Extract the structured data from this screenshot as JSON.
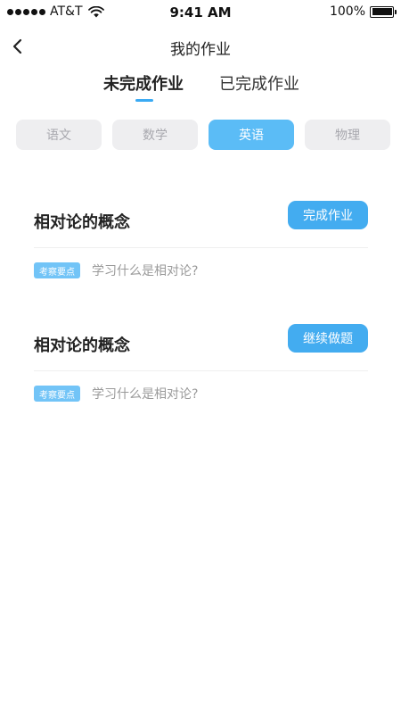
{
  "status_bar": {
    "carrier": "AT&T",
    "time": "9:41 AM",
    "battery": "100%"
  },
  "nav": {
    "title": "我的作业",
    "back_icon": "chevron-left-icon"
  },
  "tabs": [
    {
      "label": "未完成作业",
      "active": true
    },
    {
      "label": "已完成作业",
      "active": false
    }
  ],
  "subjects": [
    {
      "label": "语文",
      "selected": false
    },
    {
      "label": "数学",
      "selected": false
    },
    {
      "label": "英语",
      "selected": true
    },
    {
      "label": "物理",
      "selected": false
    }
  ],
  "assignments": [
    {
      "title": "相对论的概念",
      "action_label": "完成作业",
      "tag": "考察要点",
      "description": "学习什么是相对论?"
    },
    {
      "title": "相对论的概念",
      "action_label": "继续做题",
      "tag": "考察要点",
      "description": "学习什么是相对论?"
    }
  ],
  "colors": {
    "accent": "#43acf0",
    "chip_selected": "#5bbcf6",
    "chip_default": "#eeeef0",
    "tag_bg": "#72c4f7"
  }
}
